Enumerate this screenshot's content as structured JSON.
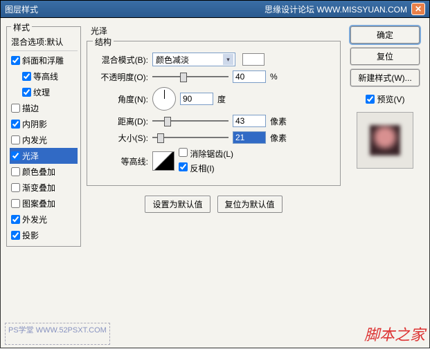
{
  "title": "图层样式",
  "titlebar_right": "思缘设计论坛  WWW.MISSYUAN.COM",
  "styles": {
    "heading": "样式",
    "blend_header": "混合选项:默认",
    "items": [
      {
        "label": "斜面和浮雕",
        "checked": true,
        "indent": false
      },
      {
        "label": "等高线",
        "checked": true,
        "indent": true
      },
      {
        "label": "纹理",
        "checked": true,
        "indent": true
      },
      {
        "label": "描边",
        "checked": false,
        "indent": false
      },
      {
        "label": "内阴影",
        "checked": true,
        "indent": false
      },
      {
        "label": "内发光",
        "checked": false,
        "indent": false
      },
      {
        "label": "光泽",
        "checked": true,
        "indent": false,
        "selected": true
      },
      {
        "label": "颜色叠加",
        "checked": false,
        "indent": false
      },
      {
        "label": "渐变叠加",
        "checked": false,
        "indent": false
      },
      {
        "label": "图案叠加",
        "checked": false,
        "indent": false
      },
      {
        "label": "外发光",
        "checked": true,
        "indent": false
      },
      {
        "label": "投影",
        "checked": true,
        "indent": false
      }
    ]
  },
  "panel": {
    "title": "光泽",
    "group": "结构",
    "blend_mode_label": "混合模式(B):",
    "blend_mode_value": "颜色减淡",
    "opacity_label": "不透明度(O):",
    "opacity_value": "40",
    "opacity_unit": "%",
    "angle_label": "角度(N):",
    "angle_value": "90",
    "angle_unit": "度",
    "distance_label": "距离(D):",
    "distance_value": "43",
    "distance_unit": "像素",
    "size_label": "大小(S):",
    "size_value": "21",
    "size_unit": "像素",
    "contour_label": "等高线:",
    "antialias_label": "消除锯齿(L)",
    "invert_label": "反相(I)",
    "btn_default": "设置为默认值",
    "btn_reset": "复位为默认值"
  },
  "right": {
    "ok": "确定",
    "reset": "复位",
    "new_style": "新建样式(W)...",
    "preview": "预览(V)"
  },
  "watermark1": "PS学堂  WWW.52PSXT.COM",
  "watermark2": "脚本之家"
}
